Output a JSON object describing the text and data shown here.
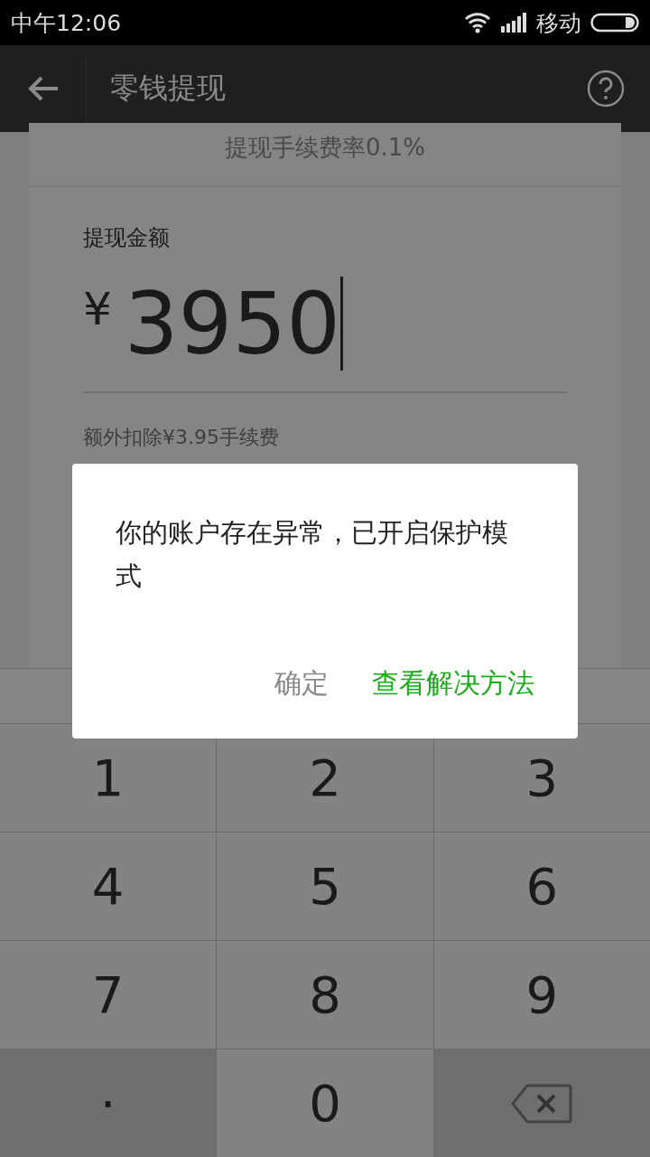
{
  "status_bar": {
    "time": "中午12:06",
    "carrier": "移动"
  },
  "header": {
    "title": "零钱提现"
  },
  "fee_rate": "提现手续费率0.1%",
  "withdraw": {
    "label": "提现金额",
    "currency": "¥",
    "amount": "3950",
    "fee_note": "额外扣除¥3.95手续费"
  },
  "keypad": [
    {
      "kind": "digit",
      "label": "1"
    },
    {
      "kind": "digit",
      "label": "2"
    },
    {
      "kind": "digit",
      "label": "3"
    },
    {
      "kind": "digit",
      "label": "4"
    },
    {
      "kind": "digit",
      "label": "5"
    },
    {
      "kind": "digit",
      "label": "6"
    },
    {
      "kind": "digit",
      "label": "7"
    },
    {
      "kind": "digit",
      "label": "8"
    },
    {
      "kind": "digit",
      "label": "9"
    },
    {
      "kind": "dot",
      "label": "."
    },
    {
      "kind": "digit",
      "label": "0"
    },
    {
      "kind": "backspace"
    }
  ],
  "dialog": {
    "message": "你的账户存在异常，已开启保护模式",
    "buttons": [
      {
        "label": "确定",
        "kind": "secondary"
      },
      {
        "label": "查看解决方法",
        "kind": "primary"
      }
    ]
  }
}
